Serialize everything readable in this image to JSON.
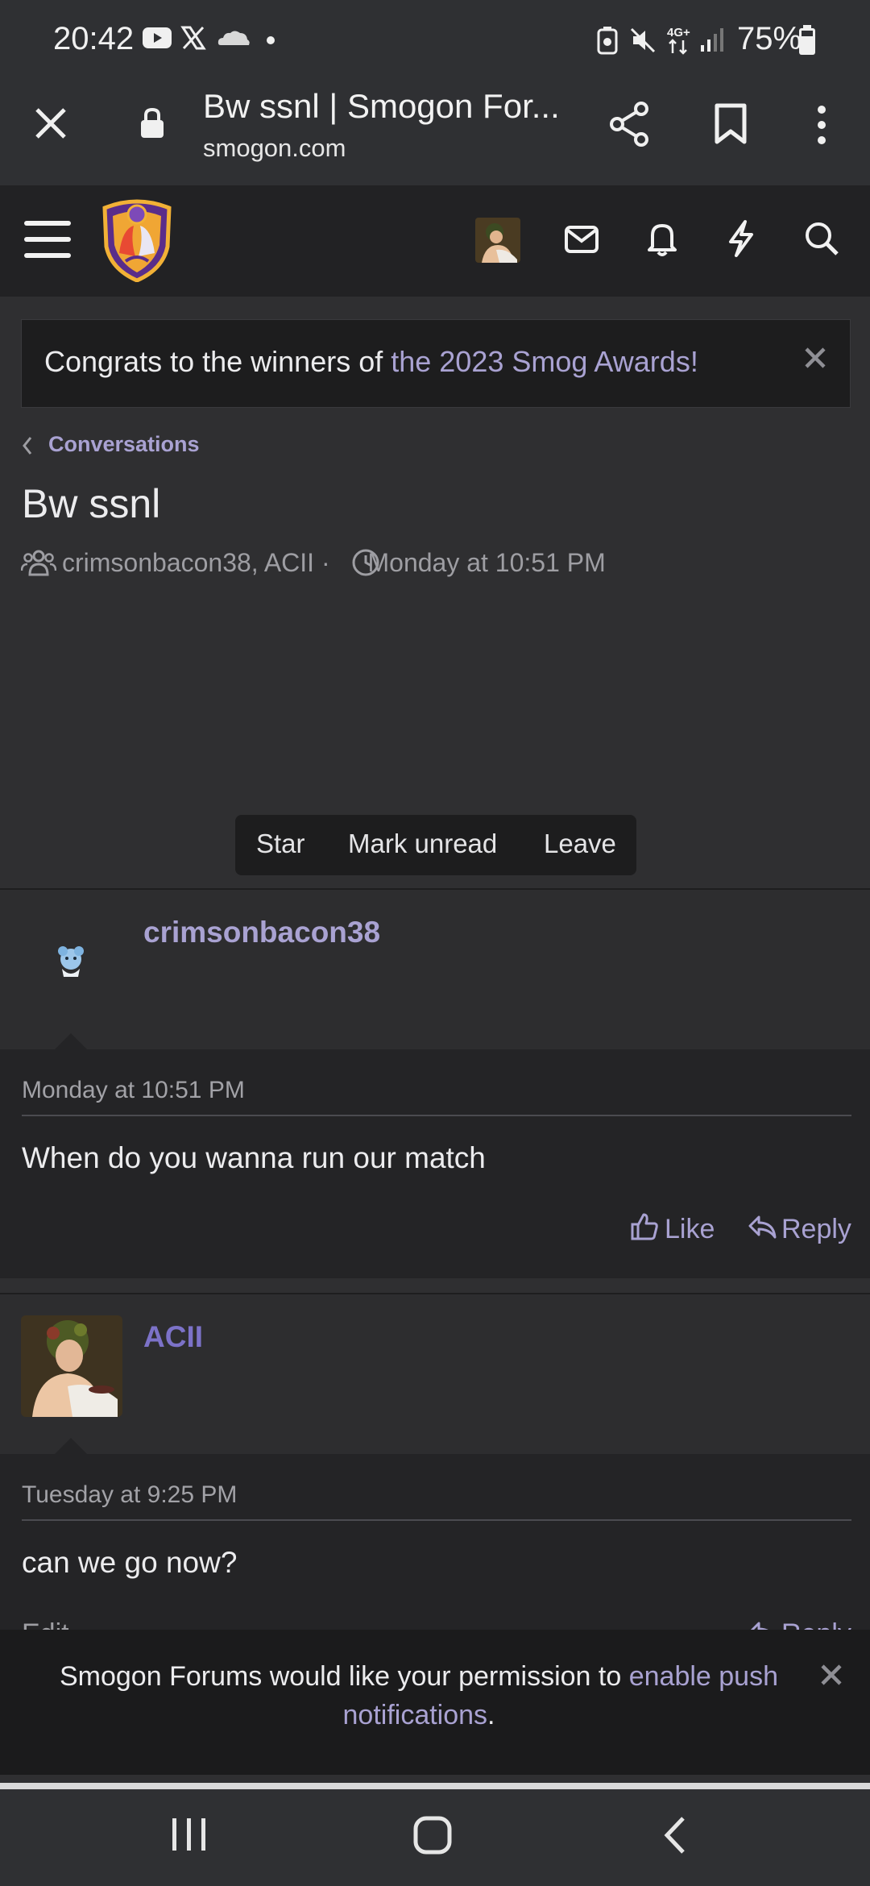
{
  "status_bar": {
    "time": "20:42",
    "battery": "75%",
    "icons": [
      "youtube-icon",
      "x-icon",
      "cloud-icon",
      "dot-icon",
      "battery-saver-icon",
      "mute-icon",
      "4g-icon",
      "signal-icon",
      "battery-icon"
    ]
  },
  "browser": {
    "tab_title": "Bw ssnl | Smogon For...",
    "domain": "smogon.com",
    "icons": [
      "close-icon",
      "lock-icon",
      "share-icon",
      "bookmark-icon",
      "more-icon"
    ]
  },
  "site_header": {
    "icons": [
      "menu-icon",
      "smogon-logo",
      "avatar",
      "mail-icon",
      "bell-icon",
      "lightning-icon",
      "search-icon"
    ]
  },
  "notice": {
    "prefix": "Congrats to the winners of ",
    "link": "the 2023 Smog Awards!"
  },
  "breadcrumb": "Conversations",
  "conversation": {
    "title": "Bw ssnl",
    "participants": "crimsonbacon38, ACII",
    "meta_separator": "·",
    "started": "Monday at 10:51 PM"
  },
  "actions": {
    "star": "Star",
    "mark_unread": "Mark unread",
    "leave": "Leave"
  },
  "messages": [
    {
      "username": "crimsonbacon38",
      "username_color": "#a9a2d2",
      "date": "Monday at 10:51 PM",
      "text": "When do you wanna run our match",
      "like": "Like",
      "reply": "Reply"
    },
    {
      "username": "ACII",
      "username_color": "#7c72c8",
      "date": "Tuesday at 9:25 PM",
      "text": "can we go now?",
      "edit": "Edit",
      "reply": "Reply"
    }
  ],
  "push_banner": {
    "prefix": "Smogon Forums would like your permission to ",
    "link": "enable push notifications",
    "suffix": "."
  },
  "colors": {
    "accent": "#a9a2d2",
    "background": "#2f2f31",
    "header": "#222224"
  }
}
